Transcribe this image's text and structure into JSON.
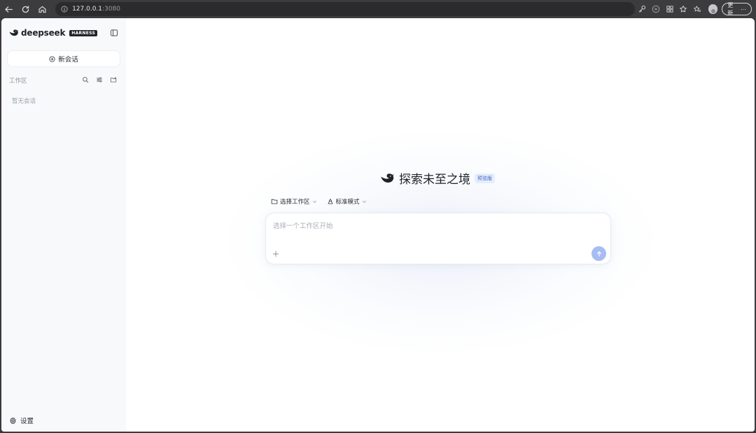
{
  "browser": {
    "url_host": "127.0.0.1",
    "url_port": ":3080",
    "update_label": "更新",
    "update_more": "⋯"
  },
  "sidebar": {
    "brand_name": "deepseek",
    "brand_badge": "HARNESS",
    "new_chat_label": "新会话",
    "workspace_label": "工作区",
    "empty_message": "暂无会话",
    "settings_label": "设置"
  },
  "main": {
    "hero_title": "探索未至之境",
    "preview_badge": "预览版",
    "workspace_selector": "选择工作区",
    "mode_selector": "标准模式",
    "composer_placeholder": "选择一个工作区开始"
  },
  "colors": {
    "brand": "#1f2329",
    "accent": "#a6bcf3",
    "badge_bg": "#e6eefc",
    "sidebar_bg": "#f8f9fb"
  }
}
